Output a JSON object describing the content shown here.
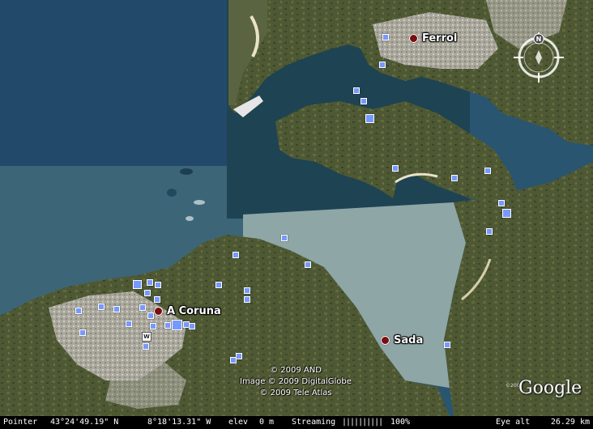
{
  "places": [
    {
      "name": "Ferrol",
      "id": "ferrol"
    },
    {
      "name": "A Coruna",
      "id": "a-coruna"
    },
    {
      "name": "Sada",
      "id": "sada"
    }
  ],
  "compass": {
    "north_label": "N"
  },
  "wiki_marker": {
    "label": "W"
  },
  "copyright": {
    "line1": "© 2009 AND",
    "line2": "Image © 2009 DigitalGlobe",
    "line3": "© 2009 Tele Atlas"
  },
  "logo": {
    "text": "Google",
    "small": "©2007"
  },
  "status": {
    "pointer_label": "Pointer",
    "latitude": "43°24'49.19\" N",
    "longitude": "8°18'13.31\" W",
    "elev_label": "elev",
    "elevation": "0 m",
    "streaming_label": "Streaming",
    "streaming_bars": "||||||||||",
    "streaming_percent": "100%",
    "eye_alt_label": "Eye alt",
    "eye_alt": "26.29 km"
  },
  "colors": {
    "ocean_deep": "#244a66",
    "ocean_shallow": "#3e6676",
    "bay_light": "#8fa7a8",
    "land": "#4f5a34",
    "urban": "#b8b6ad",
    "photo_icon": "#7799ff",
    "place_dot": "#7a0e0e"
  }
}
